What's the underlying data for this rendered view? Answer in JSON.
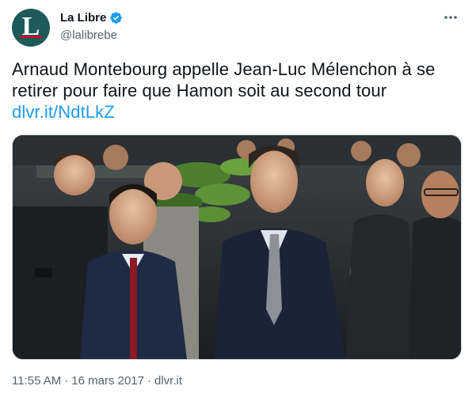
{
  "account": {
    "avatar_letter": "L",
    "display_name": "La Libre",
    "handle": "@lalibrebe",
    "verified": true
  },
  "tweet": {
    "text": "Arnaud Montebourg appelle Jean-Luc Mélenchon à se retirer pour faire que Hamon soit au second tour ",
    "link_text": "dlvr.it/NdtLkZ",
    "time": "11:55 AM",
    "separator1": "·",
    "date": "16 mars 2017",
    "separator2": "·",
    "source": "dlvr.it"
  },
  "icons": {
    "more": "more-horizontal-icon",
    "verified": "verified-badge-icon"
  },
  "colors": {
    "link": "#1d9bf0",
    "verified": "#1d9bf0",
    "avatar_bg": "#1e5a5a",
    "secondary_text": "#536471"
  }
}
